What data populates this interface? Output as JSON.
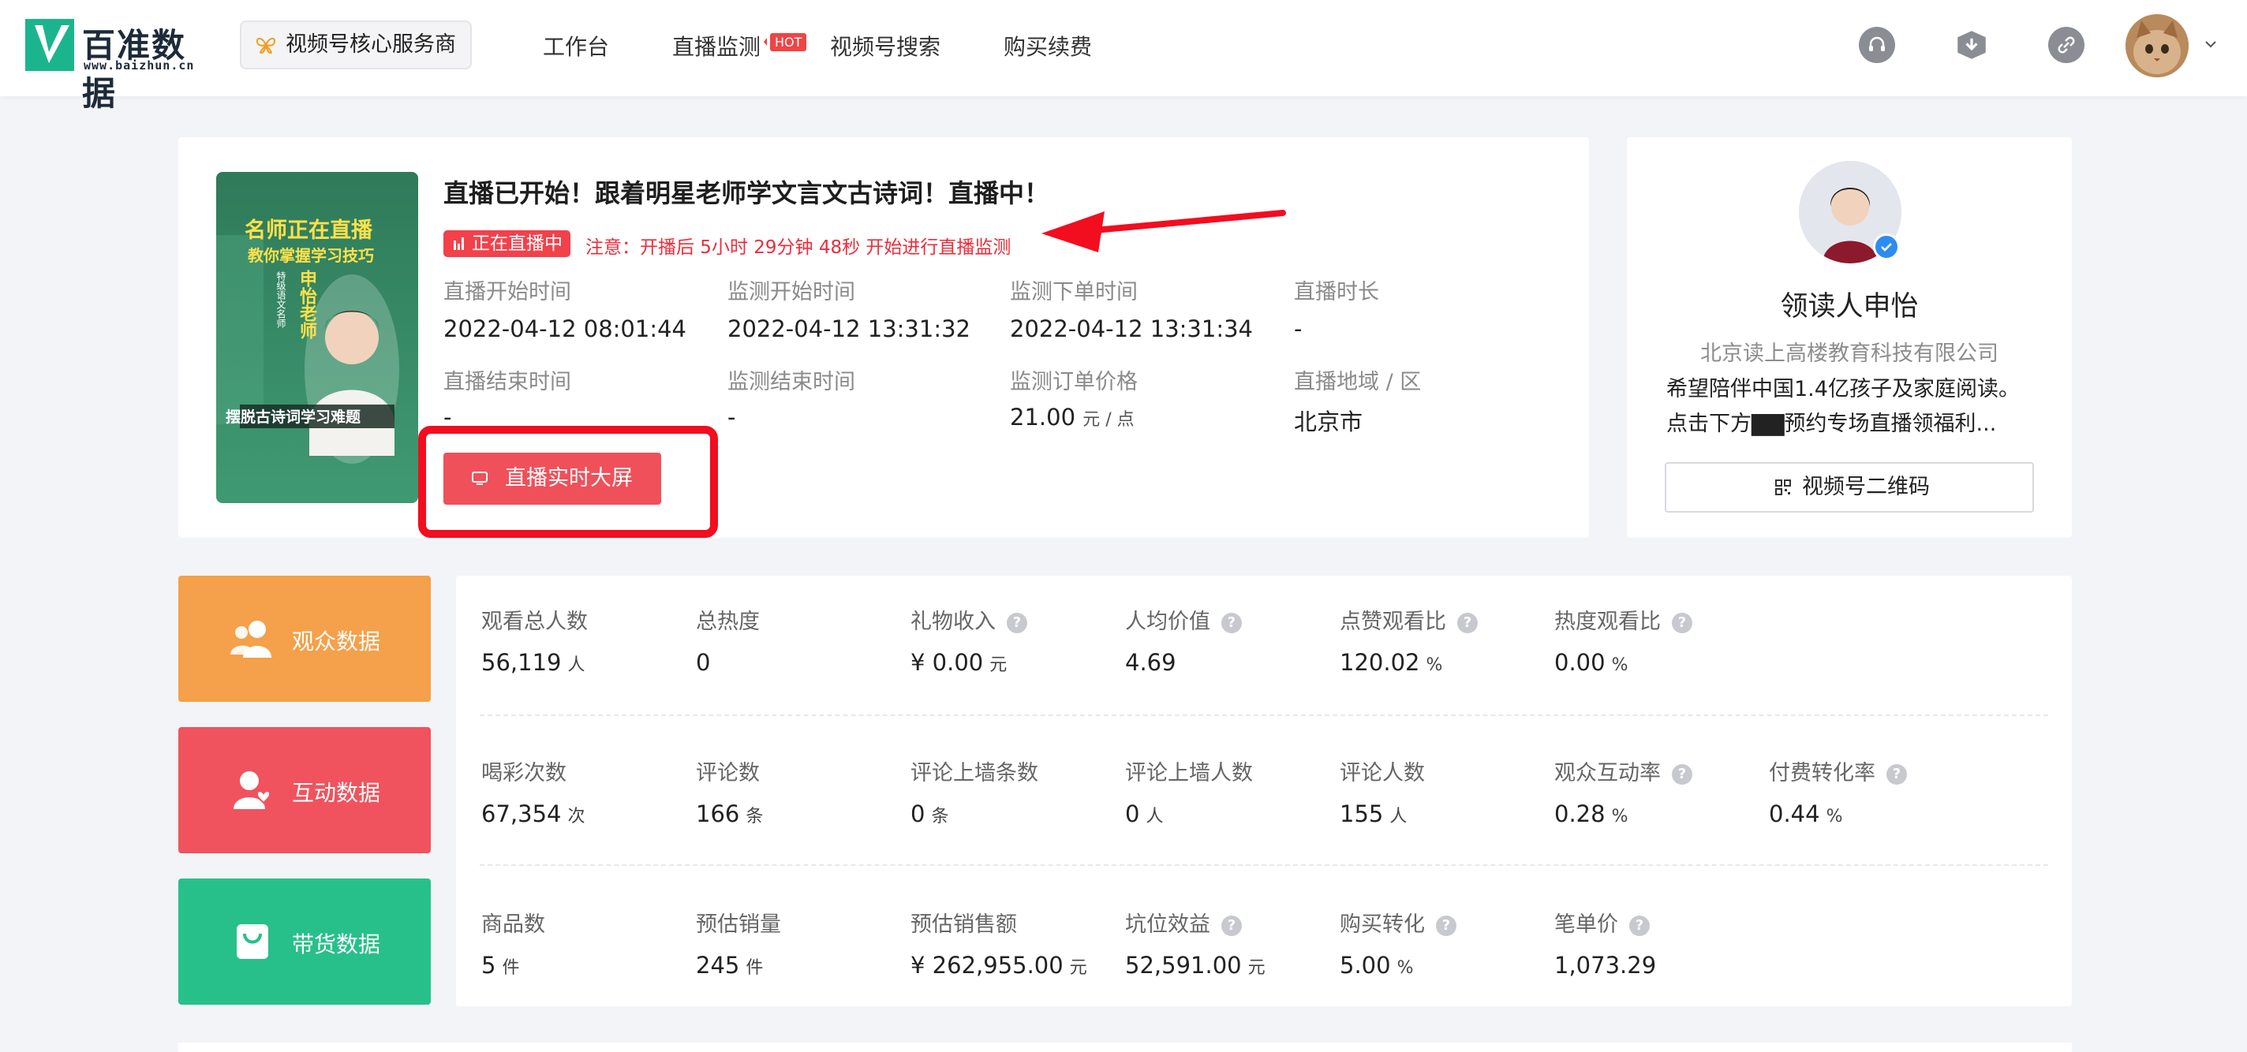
{
  "header": {
    "logo_cn": "百准数据",
    "logo_url": "www.baizhun.cn",
    "service_tag": "视频号核心服务商",
    "nav": [
      "工作台",
      "直播监测",
      "视频号搜索",
      "购买续费"
    ],
    "hot_badge": "HOT",
    "icons": [
      "headset-icon",
      "box-icon",
      "link-icon"
    ]
  },
  "live": {
    "title": "直播已开始！跟着明星老师学文言文古诗词！直播中！",
    "status_badge": "正在直播中",
    "note": "注意：开播后 5小时 29分钟 48秒 开始进行直播监测",
    "cover": {
      "headline": "名师正在直播",
      "subline": "教你掌握学习技巧",
      "teacher_tag": "申怡老师",
      "teacher_title": "特级语文名师",
      "bottom_text": "摆脱古诗词学习难题"
    },
    "fields": [
      {
        "label": "直播开始时间",
        "value": "2022-04-12 08:01:44"
      },
      {
        "label": "监测开始时间",
        "value": "2022-04-12 13:31:32"
      },
      {
        "label": "监测下单时间",
        "value": "2022-04-12 13:31:34"
      },
      {
        "label": "直播时长",
        "value": "-"
      },
      {
        "label": "直播结束时间",
        "value": "-"
      },
      {
        "label": "监测结束时间",
        "value": "-"
      },
      {
        "label": "监测订单价格",
        "value": "21.00",
        "unit": "元 / 点"
      },
      {
        "label": "直播地域 / 区",
        "value": "北京市"
      }
    ],
    "screen_button": "直播实时大屏"
  },
  "profile": {
    "name": "领读人申怡",
    "company": "北京读上高楼教育科技有限公司",
    "desc_line1": "希望陪伴中国1.4亿孩子及家庭阅读。",
    "desc_line2": "点击下方▇▇预约专场直播领福利...",
    "qr_button": "视频号二维码"
  },
  "categories": [
    {
      "label": "观众数据",
      "color": "#f5a04a"
    },
    {
      "label": "互动数据",
      "color": "#f0535d"
    },
    {
      "label": "带货数据",
      "color": "#27c08a"
    }
  ],
  "stats": [
    [
      {
        "label": "观看总人数",
        "value": "56,119",
        "unit": "人",
        "help": false
      },
      {
        "label": "总热度",
        "value": "0",
        "unit": "",
        "help": false
      },
      {
        "label": "礼物收入",
        "value": "¥ 0.00",
        "unit": "元",
        "help": true
      },
      {
        "label": "人均价值",
        "value": "4.69",
        "unit": "",
        "help": true
      },
      {
        "label": "点赞观看比",
        "value": "120.02",
        "unit": "%",
        "help": true
      },
      {
        "label": "热度观看比",
        "value": "0.00",
        "unit": "%",
        "help": true
      }
    ],
    [
      {
        "label": "喝彩次数",
        "value": "67,354",
        "unit": "次",
        "help": false
      },
      {
        "label": "评论数",
        "value": "166",
        "unit": "条",
        "help": false
      },
      {
        "label": "评论上墙条数",
        "value": "0",
        "unit": "条",
        "help": false
      },
      {
        "label": "评论上墙人数",
        "value": "0",
        "unit": "人",
        "help": false
      },
      {
        "label": "评论人数",
        "value": "155",
        "unit": "人",
        "help": false
      },
      {
        "label": "观众互动率",
        "value": "0.28",
        "unit": "%",
        "help": true
      },
      {
        "label": "付费转化率",
        "value": "0.44",
        "unit": "%",
        "help": true
      }
    ],
    [
      {
        "label": "商品数",
        "value": "5",
        "unit": "件",
        "help": false
      },
      {
        "label": "预估销量",
        "value": "245",
        "unit": "件",
        "help": false
      },
      {
        "label": "预估销售额",
        "value": "¥ 262,955.00",
        "unit": "元",
        "help": false
      },
      {
        "label": "坑位效益",
        "value": "52,591.00",
        "unit": "元",
        "help": true
      },
      {
        "label": "购买转化",
        "value": "5.00",
        "unit": "%",
        "help": true
      },
      {
        "label": "笔单价",
        "value": "1,073.29",
        "unit": "",
        "help": true
      }
    ]
  ],
  "help_glyph": "?"
}
